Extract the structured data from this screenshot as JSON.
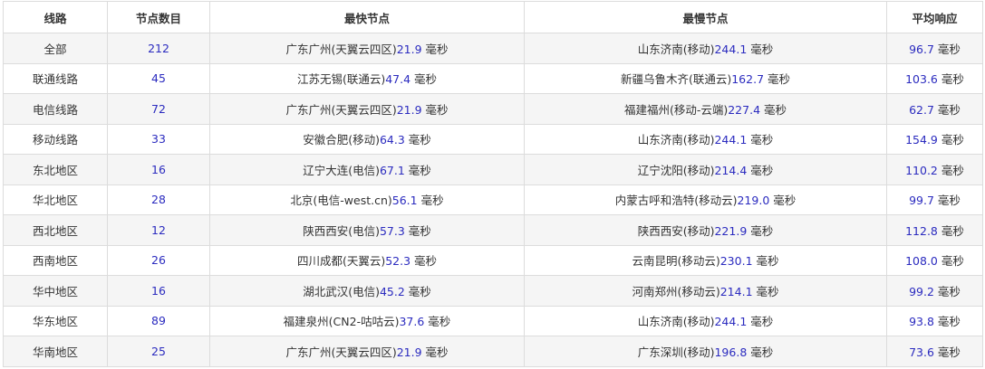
{
  "header": {
    "col_line": "线路",
    "col_count": "节点数目",
    "col_fastest": "最快节点",
    "col_slowest": "最慢节点",
    "col_avg": "平均响应"
  },
  "unit": "毫秒",
  "colors": {
    "number": "#2b2bbf",
    "text": "#333333",
    "border": "#dcdcdc",
    "stripe": "#f5f5f5"
  },
  "rows": [
    {
      "line": "全部",
      "count": "212",
      "fast_loc": "广东广州(天翼云四区)",
      "fast_ms": "21.9",
      "slow_loc": "山东济南(移动)",
      "slow_ms": "244.1",
      "avg_ms": "96.7"
    },
    {
      "line": "联通线路",
      "count": "45",
      "fast_loc": "江苏无锡(联通云)",
      "fast_ms": "47.4",
      "slow_loc": "新疆乌鲁木齐(联通云)",
      "slow_ms": "162.7",
      "avg_ms": "103.6"
    },
    {
      "line": "电信线路",
      "count": "72",
      "fast_loc": "广东广州(天翼云四区)",
      "fast_ms": "21.9",
      "slow_loc": "福建福州(移动-云端)",
      "slow_ms": "227.4",
      "avg_ms": "62.7"
    },
    {
      "line": "移动线路",
      "count": "33",
      "fast_loc": "安徽合肥(移动)",
      "fast_ms": "64.3",
      "slow_loc": "山东济南(移动)",
      "slow_ms": "244.1",
      "avg_ms": "154.9"
    },
    {
      "line": "东北地区",
      "count": "16",
      "fast_loc": "辽宁大连(电信)",
      "fast_ms": "67.1",
      "slow_loc": "辽宁沈阳(移动)",
      "slow_ms": "214.4",
      "avg_ms": "110.2"
    },
    {
      "line": "华北地区",
      "count": "28",
      "fast_loc": "北京(电信-west.cn)",
      "fast_ms": "56.1",
      "slow_loc": "内蒙古呼和浩特(移动云)",
      "slow_ms": "219.0",
      "avg_ms": "99.7"
    },
    {
      "line": "西北地区",
      "count": "12",
      "fast_loc": "陕西西安(电信)",
      "fast_ms": "57.3",
      "slow_loc": "陕西西安(移动)",
      "slow_ms": "221.9",
      "avg_ms": "112.8"
    },
    {
      "line": "西南地区",
      "count": "26",
      "fast_loc": "四川成都(天翼云)",
      "fast_ms": "52.3",
      "slow_loc": "云南昆明(移动云)",
      "slow_ms": "230.1",
      "avg_ms": "108.0"
    },
    {
      "line": "华中地区",
      "count": "16",
      "fast_loc": "湖北武汉(电信)",
      "fast_ms": "45.2",
      "slow_loc": "河南郑州(移动云)",
      "slow_ms": "214.1",
      "avg_ms": "99.2"
    },
    {
      "line": "华东地区",
      "count": "89",
      "fast_loc": "福建泉州(CN2-咕咕云)",
      "fast_ms": "37.6",
      "slow_loc": "山东济南(移动)",
      "slow_ms": "244.1",
      "avg_ms": "93.8"
    },
    {
      "line": "华南地区",
      "count": "25",
      "fast_loc": "广东广州(天翼云四区)",
      "fast_ms": "21.9",
      "slow_loc": "广东深圳(移动)",
      "slow_ms": "196.8",
      "avg_ms": "73.6"
    }
  ]
}
